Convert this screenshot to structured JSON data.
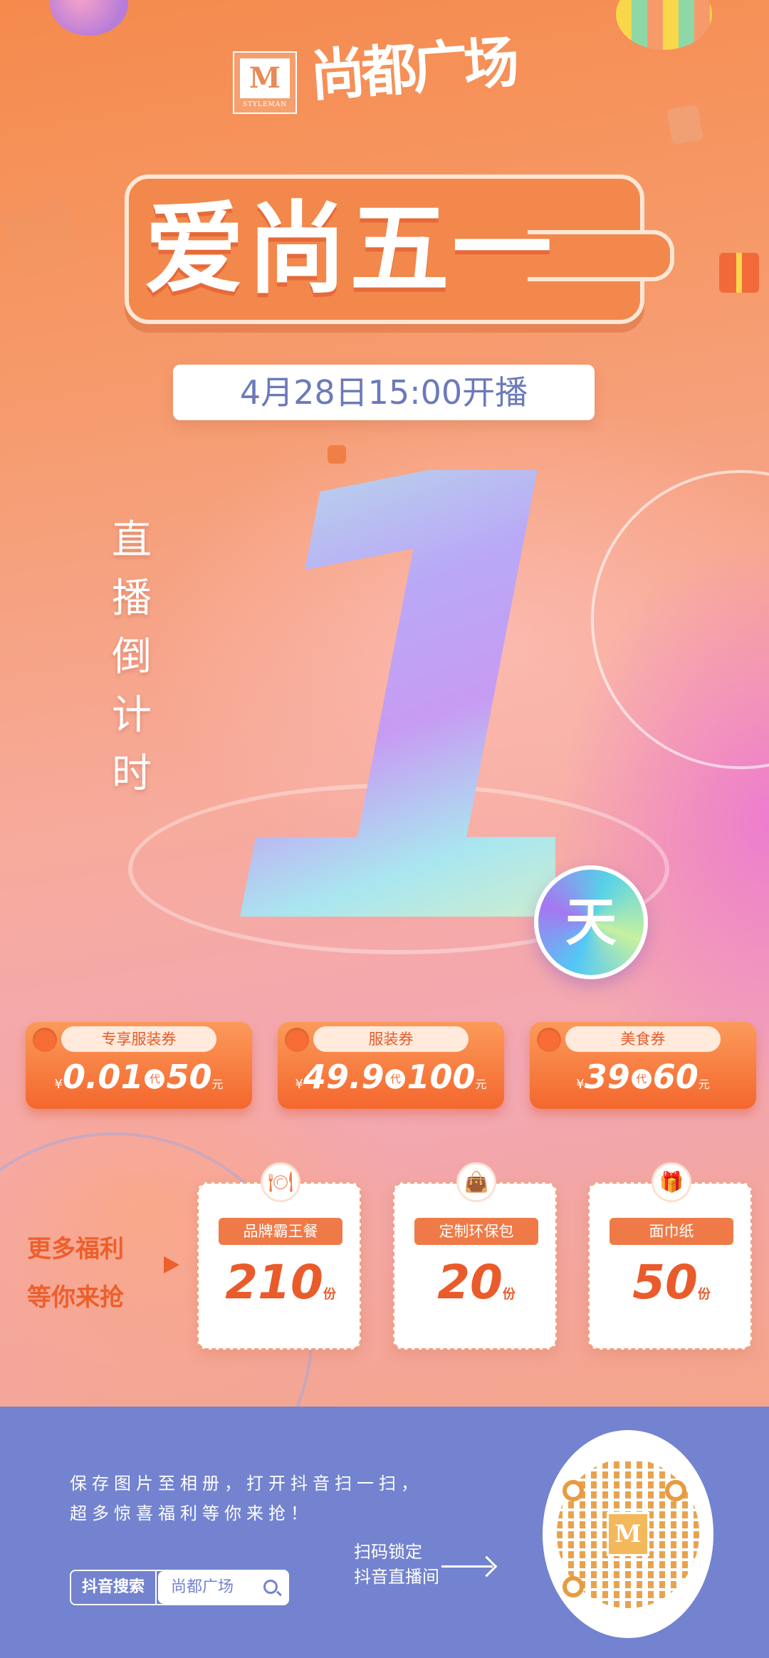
{
  "brand": {
    "logo_letter": "M",
    "logo_sub": "STYLEMAN",
    "name_script": "尚都广场"
  },
  "headline": "爱尚五一",
  "date_time": "4月28日15:00开播",
  "countdown": {
    "label_chars": [
      "直",
      "播",
      "倒",
      "计",
      "时"
    ],
    "days": "1",
    "unit": "天"
  },
  "coupons": [
    {
      "title": "专享服装券",
      "currency": "¥",
      "price": "0.01",
      "dai": "代",
      "value": "50",
      "unit": "元"
    },
    {
      "title": "服装券",
      "currency": "¥",
      "price": "49.9",
      "dai": "代",
      "value": "100",
      "unit": "元"
    },
    {
      "title": "美食券",
      "currency": "¥",
      "price": "39",
      "dai": "代",
      "value": "60",
      "unit": "元"
    }
  ],
  "welfare": {
    "line1": "更多福利",
    "line2": "等你来抢",
    "gifts": [
      {
        "name": "品牌霸王餐",
        "count": "210",
        "unit": "份",
        "icon": "cloche-icon"
      },
      {
        "name": "定制环保包",
        "count": "20",
        "unit": "份",
        "icon": "bag-icon"
      },
      {
        "name": "面巾纸",
        "count": "50",
        "unit": "份",
        "icon": "tissue-icon"
      }
    ]
  },
  "footer": {
    "line1": "保存图片至相册，打开抖音扫一扫，",
    "line2": "超多惊喜福利等你来抢！",
    "search_tag": "抖音搜索",
    "search_value": "尚都广场",
    "scan_line1": "扫码锁定",
    "scan_line2": "抖音直播间"
  },
  "colors": {
    "accent_orange": "#f26a36",
    "footer_blue": "#7383cf",
    "date_text": "#6c7aba"
  }
}
